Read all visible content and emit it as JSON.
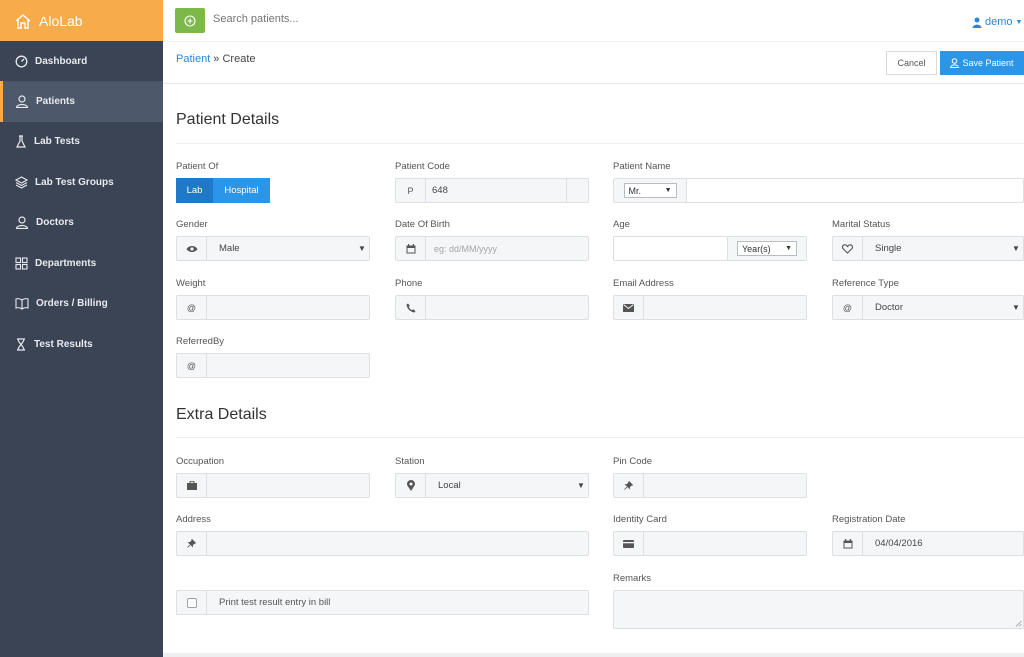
{
  "brand": {
    "name": "AloLab"
  },
  "sidebar": {
    "items": [
      {
        "label": "Dashboard"
      },
      {
        "label": "Patients"
      },
      {
        "label": "Lab Tests"
      },
      {
        "label": "Lab Test Groups"
      },
      {
        "label": "Doctors"
      },
      {
        "label": "Departments"
      },
      {
        "label": "Orders / Billing"
      },
      {
        "label": "Test Results"
      }
    ]
  },
  "topbar": {
    "search_placeholder": "Search patients...",
    "user": "demo"
  },
  "header": {
    "crumb_link": "Patient",
    "crumb_sep": " » ",
    "crumb_current": "Create",
    "cancel_label": "Cancel",
    "save_label": "Save Patient"
  },
  "patient_details": {
    "title": "Patient Details",
    "patient_of": {
      "label": "Patient Of",
      "options": [
        "Lab",
        "Hospital"
      ]
    },
    "patient_code": {
      "label": "Patient Code",
      "prefix": "P",
      "value": "648"
    },
    "patient_name": {
      "label": "Patient Name",
      "title_value": "Mr.",
      "value": ""
    },
    "gender": {
      "label": "Gender",
      "value": "Male"
    },
    "dob": {
      "label": "Date Of Birth",
      "placeholder": "eg: dd/MM/yyyy"
    },
    "age": {
      "label": "Age",
      "unit": "Year(s)"
    },
    "marital": {
      "label": "Marital Status",
      "value": "Single"
    },
    "weight": {
      "label": "Weight",
      "addon": "@"
    },
    "phone": {
      "label": "Phone"
    },
    "email": {
      "label": "Email Address"
    },
    "reference_type": {
      "label": "Reference Type",
      "addon": "@",
      "value": "Doctor"
    },
    "referred_by": {
      "label": "ReferredBy",
      "addon": "@"
    }
  },
  "extra_details": {
    "title": "Extra Details",
    "occupation": {
      "label": "Occupation"
    },
    "station": {
      "label": "Station",
      "value": "Local"
    },
    "pin_code": {
      "label": "Pin Code"
    },
    "address": {
      "label": "Address"
    },
    "identity_card": {
      "label": "Identity Card"
    },
    "registration_date": {
      "label": "Registration Date",
      "value": "04/04/2016"
    },
    "print_option": {
      "label": "Print test result entry in bill"
    },
    "remarks": {
      "label": "Remarks"
    }
  },
  "colors": {
    "brand": "#f7ab4b",
    "sidebar": "#3b4455",
    "primary": "#2b96e8",
    "lab": "#1f78c8",
    "add": "#7cb84a"
  },
  "icons": [
    "home-icon",
    "dashboard-icon",
    "user-icon",
    "flask-icon",
    "layers-icon",
    "doctor-icon",
    "grid-icon",
    "book-icon",
    "hourglass-icon",
    "plus-circle-icon",
    "eye-icon",
    "calendar-icon",
    "heart-icon",
    "phone-icon",
    "envelope-icon",
    "briefcase-icon",
    "map-marker-icon",
    "pin-icon",
    "id-card-icon"
  ]
}
